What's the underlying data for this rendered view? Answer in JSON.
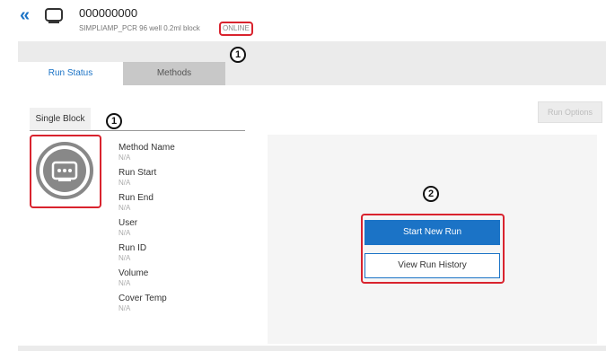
{
  "header": {
    "back_icon": "double-chevron-left-icon",
    "device_icon": "device-icon",
    "device_name": "000000000",
    "device_subtitle": "SIMPLIAMP_PCR 96 well 0.2ml block",
    "status": "ONLINE"
  },
  "tabs": [
    {
      "label": "Run Status",
      "active": true
    },
    {
      "label": "Methods",
      "active": false
    }
  ],
  "run_options_label": "Run Options",
  "block": {
    "tab_label": "Single Block",
    "icon": "thermal-block-icon"
  },
  "run_info": [
    {
      "label": "Method Name",
      "value": "N/A"
    },
    {
      "label": "Run Start",
      "value": "N/A"
    },
    {
      "label": "Run End",
      "value": "N/A"
    },
    {
      "label": "User",
      "value": "N/A"
    },
    {
      "label": "Run ID",
      "value": "N/A"
    },
    {
      "label": "Volume",
      "value": "N/A"
    },
    {
      "label": "Cover Temp",
      "value": "N/A"
    }
  ],
  "actions": {
    "start_label": "Start New Run",
    "history_label": "View Run History"
  },
  "callouts": {
    "status": "1",
    "block": "1",
    "actions": "2"
  },
  "colors": {
    "accent": "#1b73c6",
    "highlight": "#d9232e"
  }
}
